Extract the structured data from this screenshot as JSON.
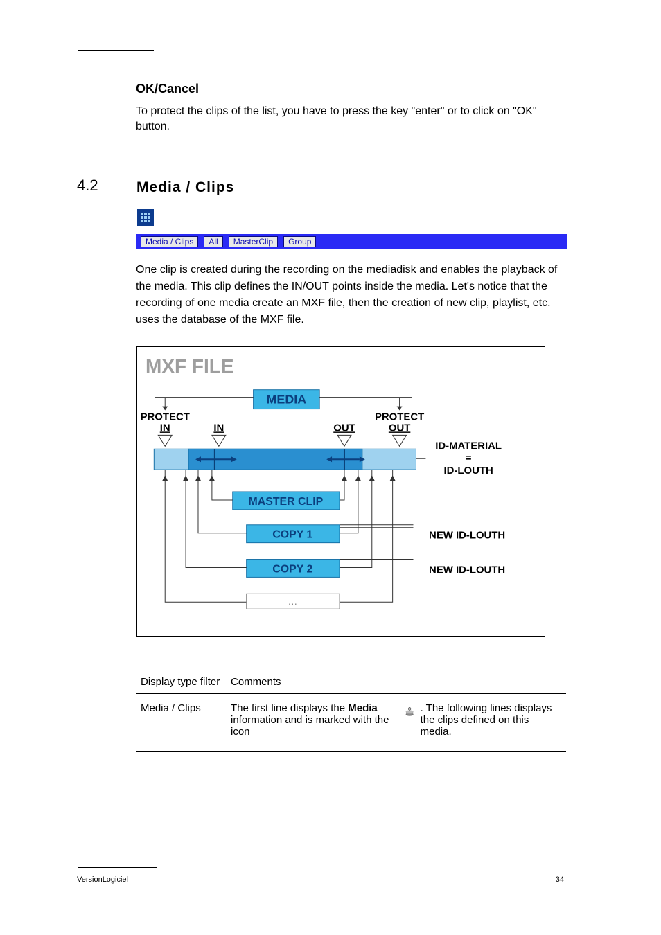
{
  "page_header": {
    "rule": true
  },
  "okcancel": {
    "heading": "OK/Cancel",
    "body": "To protect the clips of the list, you have to press the key \"enter\" or to click on \"OK\" button."
  },
  "section": {
    "number": "4.2",
    "heading": "Media  /  Clips"
  },
  "toolbar": {
    "buttons": [
      "Media / Clips",
      "All",
      "MasterClip",
      "Group"
    ]
  },
  "intro": "One clip is created during the recording on the mediadisk and enables the playback of the media. This clip defines the IN/OUT points inside the media. Let's notice that the recording of one media create an MXF file, then the creation of new clip, playlist, etc. uses the database of the MXF file.",
  "diagram": {
    "title": "MXF FILE",
    "media_label": "MEDIA",
    "protect_in": "PROTECT\nIN",
    "protect_out": "PROTECT\nOUT",
    "in": "IN",
    "out": "OUT",
    "id_material": "ID-MATERIAL",
    "equals": "=",
    "id_louth": "ID-LOUTH",
    "master_clip": "MASTER CLIP",
    "copy1": "COPY 1",
    "copy2": "COPY 2",
    "ellipsis": "…",
    "new_id_louth": "NEW ID-LOUTH"
  },
  "table": {
    "col1": "Display type filter",
    "col2": "Comments",
    "row1_filter": "Media / Clips",
    "row1_icon_name": "stack-icon",
    "row1_comment_before": "The first line displays the ",
    "row1_comment_bold": "Media",
    "row1_comment_after": " information and is marked with the icon ",
    "row1_comment_tail": ". The following lines displays the clips defined on this media."
  },
  "footer": {
    "left": "VersionLogiciel",
    "page": "34"
  }
}
